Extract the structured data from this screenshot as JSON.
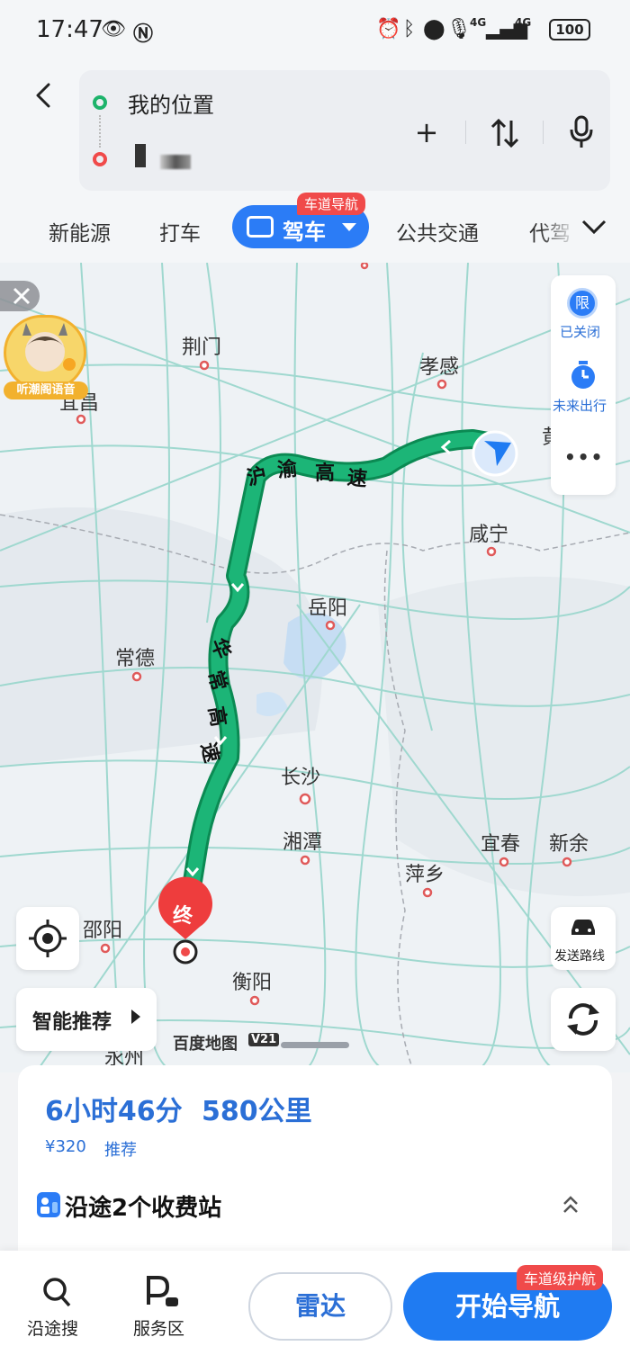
{
  "status_bar": {
    "time": "17:47",
    "battery": "100",
    "network_1": "4G",
    "network_2": "4G"
  },
  "route_input": {
    "start": "我的位置",
    "end": "▌ ▖"
  },
  "modes": {
    "new_energy": "新能源",
    "taxi": "打车",
    "drive": "驾车",
    "drive_badge": "车道导航",
    "transit": "公共交通",
    "designated": "代驾"
  },
  "map": {
    "cities": {
      "jingmen": "荆门",
      "xiaogan": "孝感",
      "yichang": "宜昌",
      "xianning": "咸宁",
      "yueyang": "岳阳",
      "changde": "常德",
      "changsha": "长沙",
      "xiangtan": "湘潭",
      "yichun": "宜春",
      "xinyu": "新余",
      "pingxiang": "萍乡",
      "shaoyang": "邵阳",
      "hengyang": "衡阳",
      "yongzhou": "永州",
      "huang": "黄"
    },
    "roads": {
      "hu_yu": [
        "沪",
        "渝",
        "高",
        "速"
      ],
      "hua_chang": [
        "华",
        "常",
        "高",
        "速"
      ]
    },
    "end_marker": "终",
    "voice_pack": "听潮阁语音",
    "logo": "百度地图",
    "logo_version": "V21"
  },
  "side_tools": {
    "restriction_icon_text": "限",
    "restriction": "已关闭",
    "future_trip": "未来出行",
    "more": "•••",
    "send_route": "发送路线"
  },
  "smart_recommend": "智能推荐",
  "summary": {
    "duration": "6小时46分",
    "distance": "580公里",
    "cost": "¥320",
    "tag": "推荐",
    "tolls": "沿途2个收费站"
  },
  "bottom_bar": {
    "search_along": "沿途搜",
    "service_area": "服务区",
    "radar": "雷达",
    "start_nav": "开始导航",
    "nav_badge": "车道级护航"
  },
  "colors": {
    "accent_blue": "#2b7cf6",
    "route_green": "#13a96a",
    "badge_red": "#f04a4a"
  }
}
